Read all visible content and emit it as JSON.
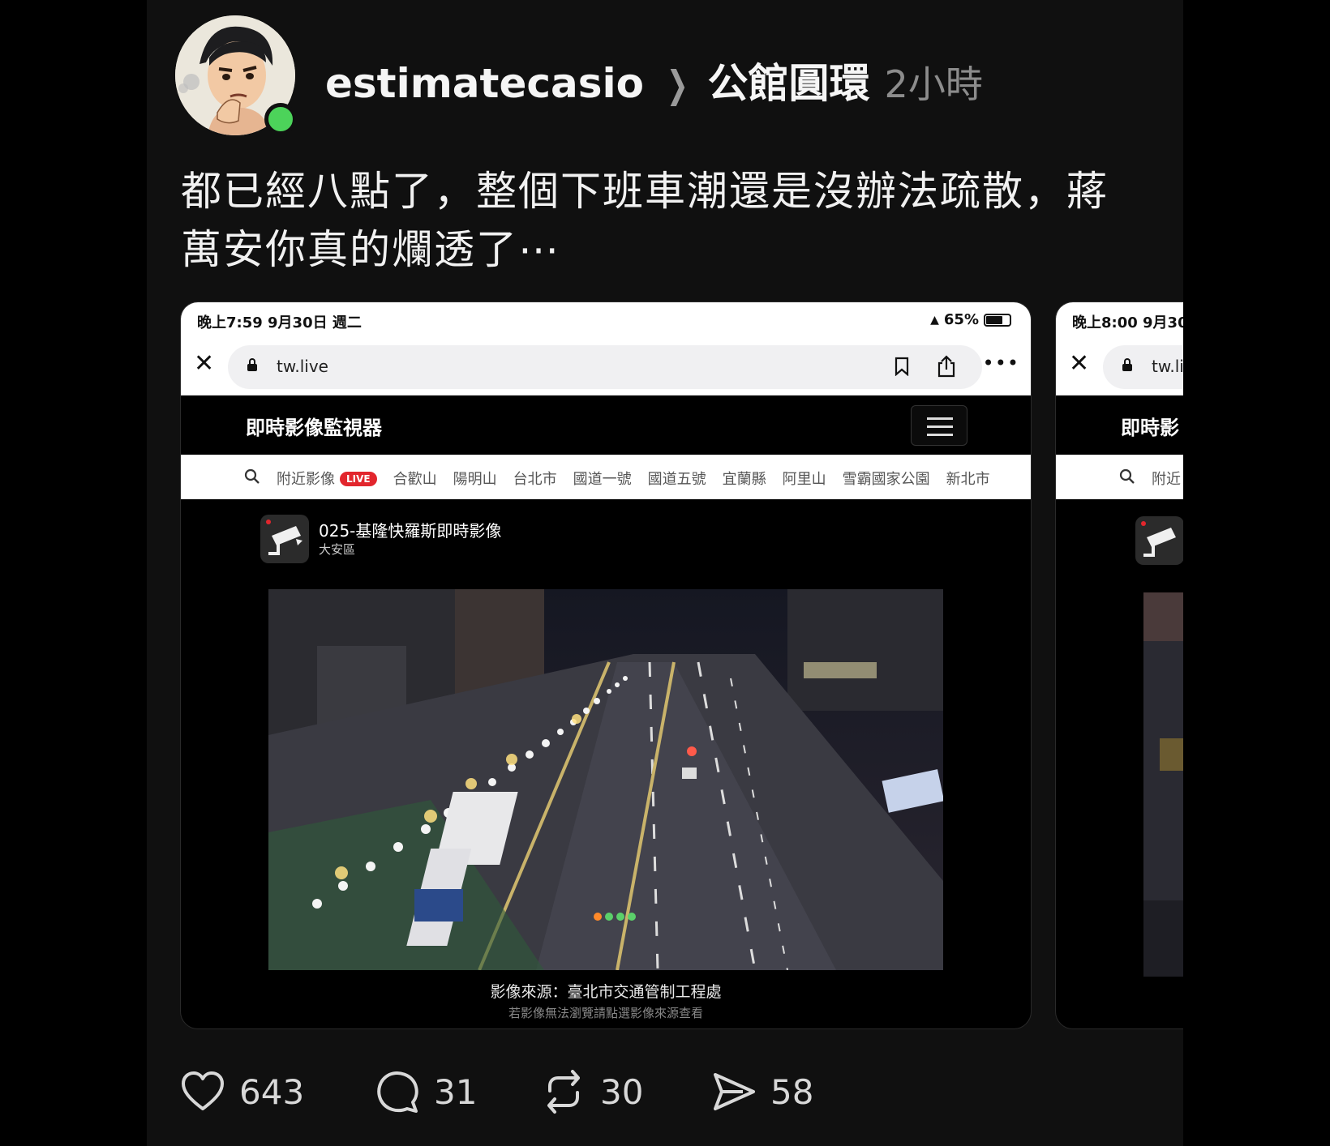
{
  "post": {
    "username": "estimatecasio",
    "topic": "公館圓環",
    "time_ago": "2小時",
    "text": "都已經八點了，整個下班車潮還是沒辦法疏散，蔣萬安你真的爛透了⋯"
  },
  "screenshot_1": {
    "status_time": "晚上7:59  9月30日 週二",
    "battery": "65%",
    "url": "tw.live",
    "site_title": "即時影像監視器",
    "nav_items": [
      "附近影像",
      "合歡山",
      "陽明山",
      "台北市",
      "國道一號",
      "國道五號",
      "宜蘭縣",
      "阿里山",
      "雪霸國家公園",
      "新北市"
    ],
    "live_tag": "LIVE",
    "camera_title": "025-基隆快羅斯即時影像",
    "camera_district": "大安區",
    "source": "影像來源：臺北市交通管制工程處",
    "source_note": "若影像無法瀏覽請點選影像來源查看"
  },
  "screenshot_2": {
    "status_time": "晚上8:00  9月30",
    "url": "tw.li",
    "site_title": "即時影",
    "nav_first": "附近"
  },
  "actions": {
    "likes": "643",
    "replies": "31",
    "reposts": "30",
    "shares": "58"
  },
  "colors": {
    "background": "#101010",
    "online": "#4cd35a",
    "live_red": "#e2262d"
  },
  "icons": [
    "heart-icon",
    "comment-icon",
    "repost-icon",
    "send-icon",
    "close-icon",
    "lock-icon",
    "bookmark-icon",
    "share-icon",
    "more-icon",
    "search-icon",
    "menu-icon",
    "camera-icon"
  ]
}
